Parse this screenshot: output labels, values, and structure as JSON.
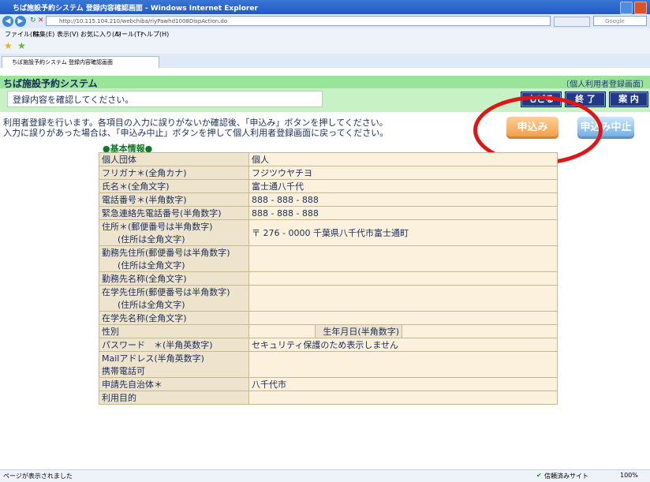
{
  "window": {
    "title": "ちば施設予約システム 登録内容確認画面 - Windows Internet Explorer",
    "url": "http://10.115.104.210/webchiba/riyPawhd1008DispAction.do",
    "search_placeholder": "Google",
    "tab_label": "ちば施設予約システム 登録内容確認画面"
  },
  "menu": [
    "ファイル(F)",
    "編集(E)",
    "表示(V)",
    "お気に入り(A)",
    "ツール(T)",
    "ヘルプ(H)"
  ],
  "app": {
    "title": "ちば施設予約システム",
    "screen_tag": "〔個人利用者登録画面〕",
    "message": "登録内容を確認してください。",
    "nav_buttons": {
      "back": "もどる",
      "end": "終 了",
      "guide": "案 内"
    }
  },
  "instructions": [
    "利用者登録を行います。各項目の入力に誤りがないか確認後、「申込み」ボタンを押してください。",
    "入力に誤りがあった場合は、「申込み中止」ボタンを押して個人利用者登録画面に戻ってください。"
  ],
  "buttons": {
    "apply": "申込み",
    "cancel": "申込み中止"
  },
  "section_heading": "●基本情報●",
  "rows": [
    {
      "label": [
        "個人団体"
      ],
      "value": "個人"
    },
    {
      "label": [
        "フリガナ＊(全角カナ)"
      ],
      "value": "フジツウヤチヨ"
    },
    {
      "label": [
        "氏名＊(全角文字)"
      ],
      "value": "富士通八千代"
    },
    {
      "label": [
        "電話番号＊(半角数字)"
      ],
      "value": "888 - 888 - 888"
    },
    {
      "label": [
        "緊急連絡先電話番号(半角数字)"
      ],
      "value": "888 - 888 - 888"
    },
    {
      "label": [
        "住所＊(郵便番号は半角数字)",
        "(住所は全角文字)"
      ],
      "value": "〒 276 - 0000 千葉県八千代市富士通町"
    },
    {
      "label": [
        "勤務先住所(郵便番号は半角数字)",
        "(住所は全角文字)"
      ],
      "value": ""
    },
    {
      "label": [
        "勤務先名称(全角文字)"
      ],
      "value": ""
    },
    {
      "label": [
        "在学先住所(郵便番号は半角数字)",
        "(住所は全角文字)"
      ],
      "value": ""
    },
    {
      "label": [
        "在学先名称(全角文字)"
      ],
      "value": ""
    },
    {
      "label": [
        "性別"
      ],
      "value": "",
      "extra_label": "生年月日(半角数字)",
      "extra_value": ""
    },
    {
      "label": [
        "パスワード　＊(半角英数字)"
      ],
      "value": "セキュリティ保護のため表示しません"
    },
    {
      "label": [
        "Mailアドレス(半角英数字)",
        "携帯電話可"
      ],
      "value": ""
    },
    {
      "label": [
        "申請先自治体＊"
      ],
      "value": "八千代市"
    },
    {
      "label": [
        "利用目的"
      ],
      "value": ""
    }
  ],
  "statusbar": {
    "left": "ページが表示されました",
    "zone": "信頼済みサイト",
    "zoom": "100%"
  },
  "colors": {
    "app_bar": "#98e498",
    "message_band": "#c6f2c6",
    "label_cell": "#eee4cd",
    "value_cell": "#fbf1dc",
    "highlight_circle": "#e11515"
  }
}
